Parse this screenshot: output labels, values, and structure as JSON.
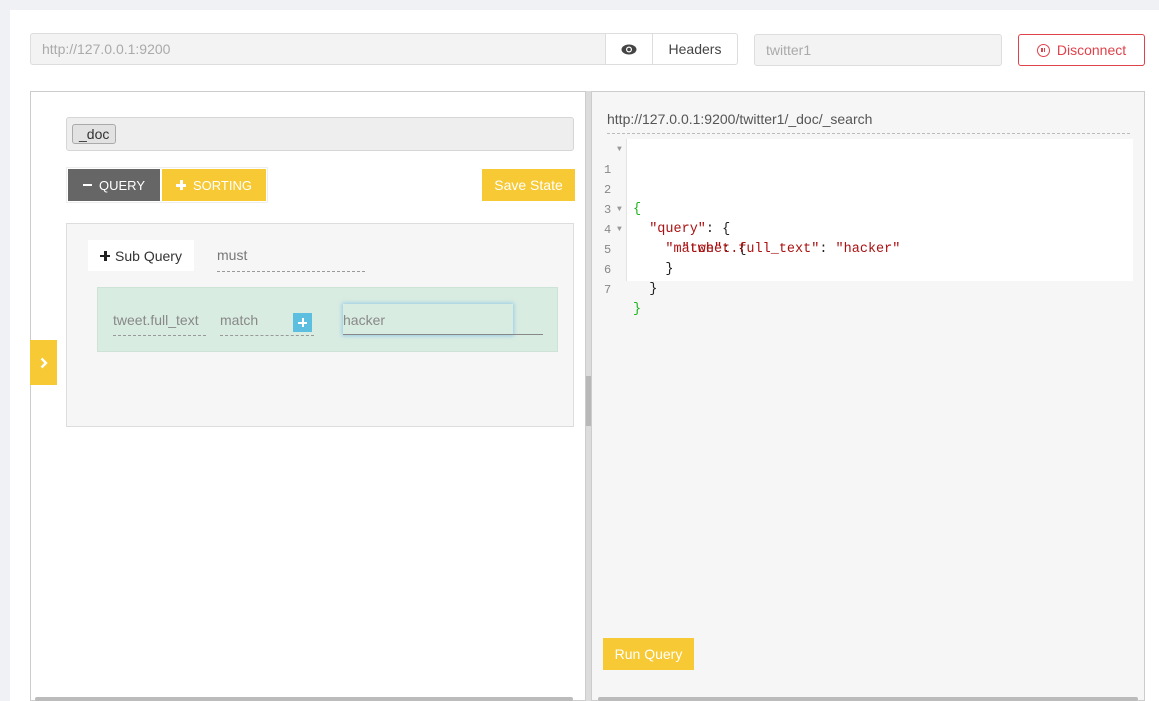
{
  "connection": {
    "url": "http://127.0.0.1:9200",
    "headers_label": "Headers",
    "index": "twitter1",
    "disconnect_label": "Disconnect",
    "eye_icon": "eye-icon",
    "disconnect_icon": "pause-circle-icon"
  },
  "builder": {
    "types": [
      "_doc"
    ],
    "query_toggle_label": "QUERY",
    "sorting_toggle_label": "SORTING",
    "save_state_label": "Save State",
    "sub_query_label": "Sub Query",
    "bool_operator": "must",
    "rules": [
      {
        "field": "tweet.full_text",
        "operator": "match",
        "value": "hacker"
      }
    ],
    "expand_icon": "chevron-right-icon"
  },
  "editor": {
    "endpoint": "http://127.0.0.1:9200/twitter1/_doc/_search",
    "lines": [
      {
        "n": "1",
        "fold": true
      },
      {
        "n": "2",
        "fold": true
      },
      {
        "n": "3",
        "fold": true
      },
      {
        "n": "4",
        "fold": false
      },
      {
        "n": "5",
        "fold": false
      },
      {
        "n": "6",
        "fold": false
      },
      {
        "n": "7",
        "fold": false
      }
    ],
    "code": {
      "l1": "{",
      "l2_key": "\"query\"",
      "l2_rest": ": {",
      "l3_key": "\"match\"",
      "l3_rest": ": {",
      "l4_key": "\"tweet.full_text\"",
      "l4_colon": ": ",
      "l4_val": "\"hacker\"",
      "l5": "}",
      "l6": "}",
      "l7": "}"
    },
    "run_query_label": "Run Query"
  }
}
